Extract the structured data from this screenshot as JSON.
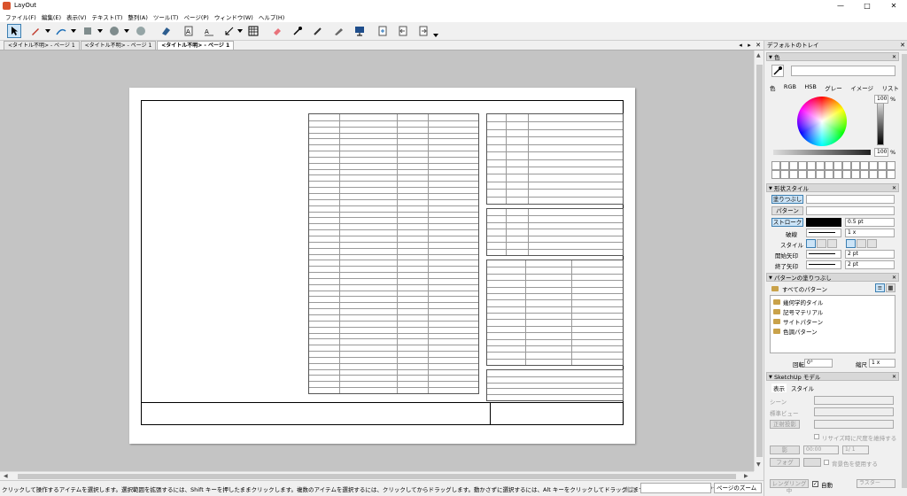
{
  "window": {
    "title": "LayOut",
    "minimize": "—",
    "maximize": "□",
    "close": "✕"
  },
  "menu": [
    "ファイル(F)",
    "編集(E)",
    "表示(V)",
    "テキスト(T)",
    "整列(A)",
    "ツール(T)",
    "ページ(P)",
    "ウィンドウ(W)",
    "ヘルプ(H)"
  ],
  "toolbar": {
    "icons": [
      "select-tool",
      "pencil-tool",
      "line-tool",
      "shape-tool",
      "circle-tool",
      "circle-alt-tool",
      "eraser-tool",
      "text-tool",
      "label-tool",
      "dimension-tool",
      "table-tool",
      "paint-tool",
      "eyedropper-tool",
      "style-tool",
      "presentation-tool",
      "add-page-tool",
      "prev-page-tool",
      "next-page-tool"
    ]
  },
  "tabs": [
    {
      "label": "<タイトル不明> - ページ 1",
      "active": false
    },
    {
      "label": "<タイトル不明> - ページ 1",
      "active": false
    },
    {
      "label": "<タイトル不明> - ページ 1",
      "active": true
    }
  ],
  "tab_controls": {
    "left": "◂",
    "right": "▸",
    "close": "✕"
  },
  "tray": {
    "title": "デフォルトのトレイ",
    "color": {
      "header": "色",
      "tabs": [
        "色",
        "RGB",
        "HSB",
        "グレー",
        "イメージ",
        "リスト"
      ],
      "percent1": "100",
      "percent2": "100",
      "pct_sign": "%"
    },
    "shape_style": {
      "header": "形状スタイル",
      "fill_label": "塗りつぶし",
      "pattern_label": "パターン",
      "stroke_label": "ストローク",
      "stroke_width": "0.5 pt",
      "dash_label": "破線",
      "dash_value": "1 x",
      "style_label": "スタイル",
      "start_arrow_label": "開始矢印",
      "start_arrow_value": "2 pt",
      "end_arrow_label": "終了矢印",
      "end_arrow_value": "2 pt"
    },
    "pattern_fill": {
      "header": "パターンの塗りつぶし",
      "select_value": "すべてのパターン",
      "items": [
        "幾何学的タイル",
        "記号マテリアル",
        "サイトパターン",
        "色調パターン"
      ],
      "rotation_label": "回転",
      "rotation_value": "0°",
      "scale_label": "縮尺",
      "scale_value": "1 x"
    },
    "sketchup": {
      "header": "SketchUp モデル",
      "tabs": [
        "表示",
        "スタイル"
      ],
      "scene_label": "シーン",
      "view_label": "標準ビュー",
      "ortho_label": "正射投影",
      "preserve_label": "リサイズ時に尺度を維持する",
      "shadow_label": "影",
      "time_value": "00:00",
      "date_value": "1/ 1",
      "fog_label": "フォグ",
      "bg_label": "背景色を使用する",
      "render_button": "レンダリング中",
      "auto_label": "自動",
      "mode_label": "ラスター"
    }
  },
  "status": {
    "text": "クリックして操作するアイテムを選択します。選択範囲を拡張するには、Shift キーを押したままクリックします。複数のアイテムを選択するには、クリックしてからドラッグします。動かさずに選択するには、Alt キーをクリックしてドラッグします。エディタを閉じには、ダブルクリックし",
    "measure_label": "測定",
    "zoom": "ページのズーム"
  }
}
